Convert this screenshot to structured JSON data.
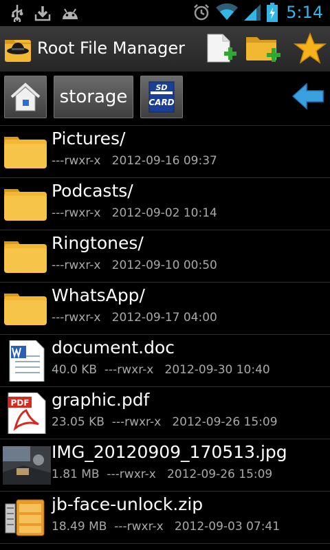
{
  "status_bar": {
    "time": "5:14",
    "icons": [
      "usb-icon",
      "download-icon",
      "android-icon",
      "alarm-icon",
      "wifi-icon",
      "signal-icon",
      "battery-icon"
    ]
  },
  "title_bar": {
    "title": "Root File Manager",
    "actions": [
      "new-file-button",
      "new-folder-button",
      "bookmarks-button"
    ]
  },
  "path_bar": {
    "crumb": "storage",
    "sd_label": "CARD",
    "sd_top": "SD"
  },
  "files": [
    {
      "name": "Pictures/",
      "meta": "---rwxr-x   2012-09-16 09:37",
      "type": "folder"
    },
    {
      "name": "Podcasts/",
      "meta": "---rwxr-x   2012-09-02 10:14",
      "type": "folder"
    },
    {
      "name": "Ringtones/",
      "meta": "---rwxr-x   2012-09-10 00:50",
      "type": "folder"
    },
    {
      "name": "WhatsApp/",
      "meta": "---rwxr-x   2012-09-17 04:00",
      "type": "folder"
    },
    {
      "name": "document.doc",
      "meta": "40.0 KB  ---rwxr-x   2012-09-30 10:40",
      "type": "doc"
    },
    {
      "name": "graphic.pdf",
      "meta": "23.05 KB  ---rwxr-x   2012-09-26 15:09",
      "type": "pdf"
    },
    {
      "name": "IMG_20120909_170513.jpg",
      "meta": "1.81 MB  ---rwxr-x   2012-09-26 15:09",
      "type": "image"
    },
    {
      "name": "jb-face-unlock.zip",
      "meta": "18.49 MB  ---rwxr-x   2012-09-03 07:41",
      "type": "zip"
    }
  ],
  "colors": {
    "accent": "#33b5e5",
    "folder": "#f2b733",
    "meta_text": "#a9a9a9"
  }
}
